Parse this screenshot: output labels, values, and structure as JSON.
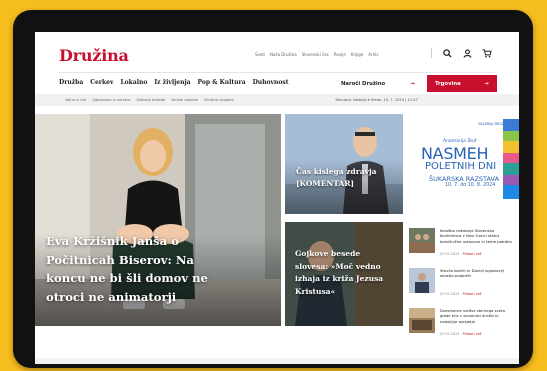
{
  "site": {
    "logo": "Družina"
  },
  "top_links": [
    "Sveti",
    "Naša Družina",
    "Slovenski čas",
    "Revije",
    "Knjige",
    "Arhiv"
  ],
  "icons": [
    "search-icon",
    "user-icon",
    "cart-icon"
  ],
  "nav": [
    "Družba",
    "Cerkev",
    "Lokalno",
    "Iz življenja",
    "Pop & Kultura",
    "Duhovnost"
  ],
  "actions": {
    "naroci": "Naroči Družino",
    "trgovina": "Trgovina",
    "arrow": "→"
  },
  "tags": [
    "Vojna in mir",
    "Zgodovina in verstva",
    "Gojkove besede",
    "Verske vsebine",
    "Družina vpogled"
  ],
  "subinfo": "Trenutno: Nedelja ▾ Sreda, 10. 7. 2024 | 11:57",
  "hero": {
    "title": "Eva Kržišnik Janša o Počitnicah Biserov: Na koncu ne bi šli domov ne otroci ne animatorji"
  },
  "card1": {
    "title": "Čas kislega zdravja [KOMENTAR]"
  },
  "card2": {
    "title": "Gojkove besede slovesa: »Moč vedno izhaja iz križa Jezusa Kristusa«"
  },
  "ad": {
    "tag1": "GALERIJA DRUŽINA",
    "tag2": "Anamarija Štuf",
    "big1": "NASMEH",
    "big2": "POLETNIH DNI",
    "big3": "ŠUKARSKA RAZSTAVA",
    "dates": "10. 7. do 10. 8. 2024"
  },
  "news": [
    {
      "text": "Koroška nekdanja Slovenska Konferenca v Novi Gorici statut bolnišnične ustanove in teme potrdila",
      "date": "07.07.2024",
      "more": "Preberi več"
    },
    {
      "text": "Stevilo bolnih in Davidi Jugoslaviji okrožja podprtih",
      "date": "07.07.2024",
      "more": "Preberi več"
    },
    {
      "text": "Dvosmerne volitve zbirnega sveta glede kriz v slovenski družbi in nadaljnje sprejetje",
      "date": "07.07.2024",
      "more": "Preberi več"
    }
  ],
  "colors": {
    "brand": "#c8102e",
    "background": "#f6bd1e",
    "ad_blue": "#2a63b7"
  }
}
